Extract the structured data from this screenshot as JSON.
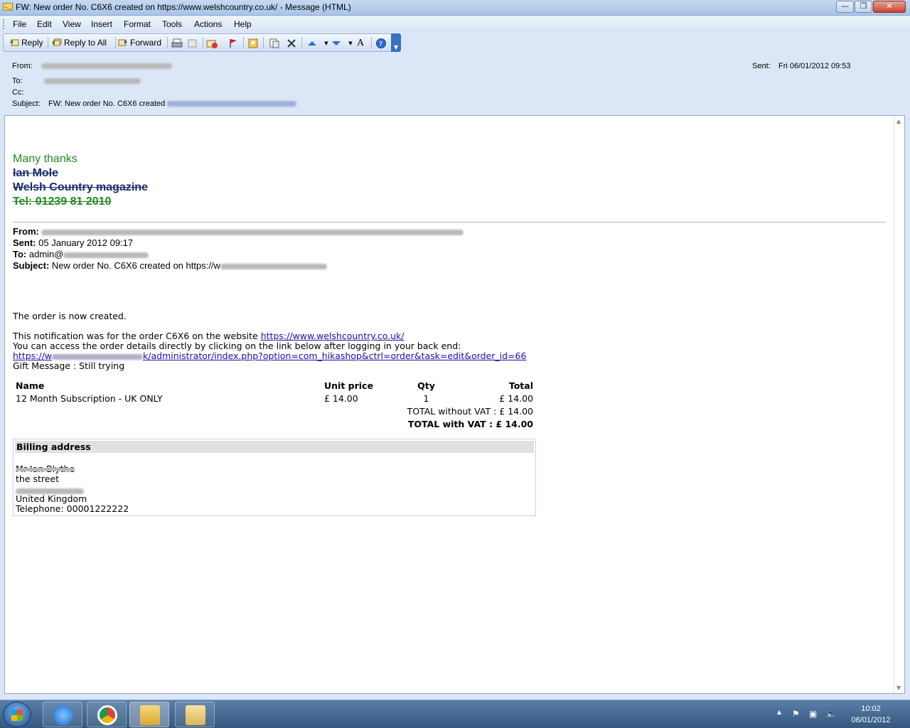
{
  "window": {
    "title": "FW: New order No. C6X6 created on https://www.welshcountry.co.uk/ - Message (HTML)",
    "min_glyph": "—",
    "max_glyph": "❐",
    "close_glyph": "✕"
  },
  "menu": [
    "File",
    "Edit",
    "View",
    "Insert",
    "Format",
    "Tools",
    "Actions",
    "Help"
  ],
  "toolbar": {
    "reply": "Reply",
    "reply_all": "Reply to All",
    "forward": "Forward"
  },
  "header": {
    "from_label": "From:",
    "to_label": "To:",
    "cc_label": "Cc:",
    "subject_label": "Subject:",
    "subject": "FW: New order No. C6X6 created",
    "sent_label": "Sent:",
    "sent_value": "Fri 06/01/2012 09:53"
  },
  "signature": {
    "thanks": "Many thanks",
    "name": "Ian Mole",
    "company": "Welsh Country magazine",
    "tel": "Tel: 01239 81 2010"
  },
  "forwarded": {
    "from_label": "From:",
    "sent_label": "Sent:",
    "sent_value": "05 January 2012 09:17",
    "to_label": "To:",
    "to_value": "admin@",
    "subject_label": "Subject:",
    "subject_value": "New order No. C6X6 created on https://w"
  },
  "message": {
    "created": "The order is now created.",
    "notification_prefix": "This notification was for the order C6X6 on the website",
    "website_link": "https://www.welshcountry.co.uk/",
    "access_text": "You can access the order details directly by clicking on the link below after logging in your back end:",
    "admin_link_start": "https://w",
    "admin_link_end": "k/administrator/index.php?option=com_hikashop&ctrl=order&task=edit&order_id=66",
    "gift": "Gift Message : Still trying"
  },
  "order_table": {
    "headers": {
      "name": "Name",
      "unit_price": "Unit price",
      "qty": "Qty",
      "total": "Total"
    },
    "row": {
      "name": "12 Month Subscription - UK ONLY",
      "unit_price": "£ 14.00",
      "qty": "1",
      "total": "£ 14.00"
    },
    "total_without_vat": "TOTAL without VAT : £ 14.00",
    "total_with_vat": "TOTAL with VAT : £ 14.00"
  },
  "billing": {
    "title": "Billing address",
    "name": "Mr Ian Blythe",
    "street": "the street",
    "country": "United Kingdom",
    "telephone": "Telephone: 00001222222"
  },
  "clock": {
    "time": "10:02",
    "date": "06/01/2012"
  }
}
